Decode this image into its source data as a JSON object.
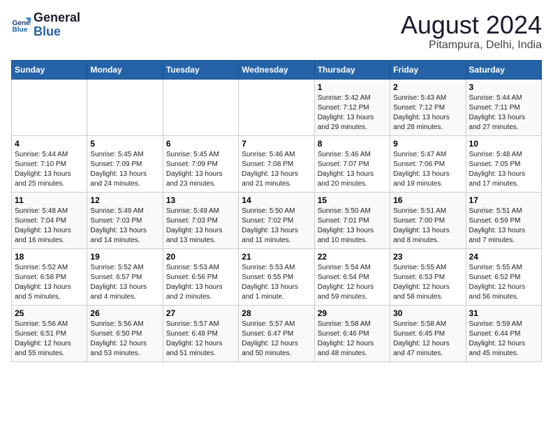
{
  "logo": {
    "line1": "General",
    "line2": "Blue"
  },
  "title": "August 2024",
  "subtitle": "Pitampura, Delhi, India",
  "days_header": [
    "Sunday",
    "Monday",
    "Tuesday",
    "Wednesday",
    "Thursday",
    "Friday",
    "Saturday"
  ],
  "weeks": [
    [
      {
        "day": "",
        "info": ""
      },
      {
        "day": "",
        "info": ""
      },
      {
        "day": "",
        "info": ""
      },
      {
        "day": "",
        "info": ""
      },
      {
        "day": "1",
        "info": "Sunrise: 5:42 AM\nSunset: 7:12 PM\nDaylight: 13 hours\nand 29 minutes."
      },
      {
        "day": "2",
        "info": "Sunrise: 5:43 AM\nSunset: 7:12 PM\nDaylight: 13 hours\nand 28 minutes."
      },
      {
        "day": "3",
        "info": "Sunrise: 5:44 AM\nSunset: 7:11 PM\nDaylight: 13 hours\nand 27 minutes."
      }
    ],
    [
      {
        "day": "4",
        "info": "Sunrise: 5:44 AM\nSunset: 7:10 PM\nDaylight: 13 hours\nand 25 minutes."
      },
      {
        "day": "5",
        "info": "Sunrise: 5:45 AM\nSunset: 7:09 PM\nDaylight: 13 hours\nand 24 minutes."
      },
      {
        "day": "6",
        "info": "Sunrise: 5:45 AM\nSunset: 7:09 PM\nDaylight: 13 hours\nand 23 minutes."
      },
      {
        "day": "7",
        "info": "Sunrise: 5:46 AM\nSunset: 7:08 PM\nDaylight: 13 hours\nand 21 minutes."
      },
      {
        "day": "8",
        "info": "Sunrise: 5:46 AM\nSunset: 7:07 PM\nDaylight: 13 hours\nand 20 minutes."
      },
      {
        "day": "9",
        "info": "Sunrise: 5:47 AM\nSunset: 7:06 PM\nDaylight: 13 hours\nand 19 minutes."
      },
      {
        "day": "10",
        "info": "Sunrise: 5:48 AM\nSunset: 7:05 PM\nDaylight: 13 hours\nand 17 minutes."
      }
    ],
    [
      {
        "day": "11",
        "info": "Sunrise: 5:48 AM\nSunset: 7:04 PM\nDaylight: 13 hours\nand 16 minutes."
      },
      {
        "day": "12",
        "info": "Sunrise: 5:49 AM\nSunset: 7:03 PM\nDaylight: 13 hours\nand 14 minutes."
      },
      {
        "day": "13",
        "info": "Sunrise: 5:49 AM\nSunset: 7:03 PM\nDaylight: 13 hours\nand 13 minutes."
      },
      {
        "day": "14",
        "info": "Sunrise: 5:50 AM\nSunset: 7:02 PM\nDaylight: 13 hours\nand 11 minutes."
      },
      {
        "day": "15",
        "info": "Sunrise: 5:50 AM\nSunset: 7:01 PM\nDaylight: 13 hours\nand 10 minutes."
      },
      {
        "day": "16",
        "info": "Sunrise: 5:51 AM\nSunset: 7:00 PM\nDaylight: 13 hours\nand 8 minutes."
      },
      {
        "day": "17",
        "info": "Sunrise: 5:51 AM\nSunset: 6:59 PM\nDaylight: 13 hours\nand 7 minutes."
      }
    ],
    [
      {
        "day": "18",
        "info": "Sunrise: 5:52 AM\nSunset: 6:58 PM\nDaylight: 13 hours\nand 5 minutes."
      },
      {
        "day": "19",
        "info": "Sunrise: 5:52 AM\nSunset: 6:57 PM\nDaylight: 13 hours\nand 4 minutes."
      },
      {
        "day": "20",
        "info": "Sunrise: 5:53 AM\nSunset: 6:56 PM\nDaylight: 13 hours\nand 2 minutes."
      },
      {
        "day": "21",
        "info": "Sunrise: 5:53 AM\nSunset: 6:55 PM\nDaylight: 13 hours\nand 1 minute."
      },
      {
        "day": "22",
        "info": "Sunrise: 5:54 AM\nSunset: 6:54 PM\nDaylight: 12 hours\nand 59 minutes."
      },
      {
        "day": "23",
        "info": "Sunrise: 5:55 AM\nSunset: 6:53 PM\nDaylight: 12 hours\nand 58 minutes."
      },
      {
        "day": "24",
        "info": "Sunrise: 5:55 AM\nSunset: 6:52 PM\nDaylight: 12 hours\nand 56 minutes."
      }
    ],
    [
      {
        "day": "25",
        "info": "Sunrise: 5:56 AM\nSunset: 6:51 PM\nDaylight: 12 hours\nand 55 minutes."
      },
      {
        "day": "26",
        "info": "Sunrise: 5:56 AM\nSunset: 6:50 PM\nDaylight: 12 hours\nand 53 minutes."
      },
      {
        "day": "27",
        "info": "Sunrise: 5:57 AM\nSunset: 6:48 PM\nDaylight: 12 hours\nand 51 minutes."
      },
      {
        "day": "28",
        "info": "Sunrise: 5:57 AM\nSunset: 6:47 PM\nDaylight: 12 hours\nand 50 minutes."
      },
      {
        "day": "29",
        "info": "Sunrise: 5:58 AM\nSunset: 6:46 PM\nDaylight: 12 hours\nand 48 minutes."
      },
      {
        "day": "30",
        "info": "Sunrise: 5:58 AM\nSunset: 6:45 PM\nDaylight: 12 hours\nand 47 minutes."
      },
      {
        "day": "31",
        "info": "Sunrise: 5:59 AM\nSunset: 6:44 PM\nDaylight: 12 hours\nand 45 minutes."
      }
    ]
  ]
}
